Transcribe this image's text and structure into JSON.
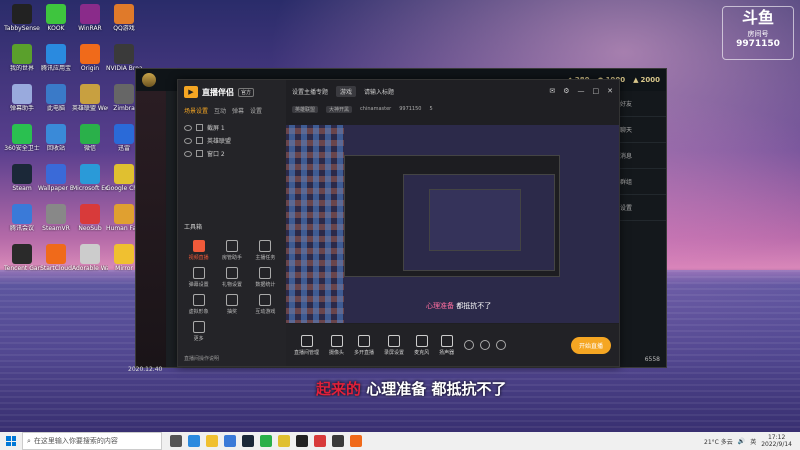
{
  "desktop": {
    "icons": [
      {
        "label": "TabbySense",
        "color": "#222"
      },
      {
        "label": "KOOK",
        "color": "#3ec53e"
      },
      {
        "label": "WinRAR",
        "color": "#8a2b8a"
      },
      {
        "label": "QQ游戏",
        "color": "#e07a2a"
      },
      {
        "label": "我的世界",
        "color": "#5aa02c"
      },
      {
        "label": "腾讯应用宝",
        "color": "#2a8adf"
      },
      {
        "label": "Origin",
        "color": "#f06a1a"
      },
      {
        "label": "NVIDIA Broadcast",
        "color": "#3a3a3a"
      },
      {
        "label": "弹幕助手",
        "color": "#9ad"
      },
      {
        "label": "此电脑",
        "color": "#3a7ac8"
      },
      {
        "label": "英雄联盟 WeGame版",
        "color": "#c8a040"
      },
      {
        "label": "Zimbra",
        "color": "#666"
      },
      {
        "label": "360安全卫士",
        "color": "#2ac050"
      },
      {
        "label": "回收站",
        "color": "#3a8ad8"
      },
      {
        "label": "微信",
        "color": "#2ab04a"
      },
      {
        "label": "迅雷",
        "color": "#2a6ad8"
      },
      {
        "label": "Steam",
        "color": "#1b2838"
      },
      {
        "label": "Wallpaper Engine",
        "color": "#3a6ad8"
      },
      {
        "label": "Microsoft Edge",
        "color": "#2a9ad8"
      },
      {
        "label": "Google Chrome",
        "color": "#e0c030"
      },
      {
        "label": "腾讯会议",
        "color": "#3a7ad8"
      },
      {
        "label": "SteamVR",
        "color": "#888"
      },
      {
        "label": "NeoSub",
        "color": "#d83a3a"
      },
      {
        "label": "Human Fall Flat",
        "color": "#e0a030"
      },
      {
        "label": "Tencent Gamemaster",
        "color": "#2a2a2a"
      },
      {
        "label": "StartCloud",
        "color": "#f06a1a"
      },
      {
        "label": "Adorable Wallpaper",
        "color": "#ccc"
      },
      {
        "label": "Mirror",
        "color": "#f0c030"
      }
    ],
    "douyu_badge": {
      "logo": "斗鱼",
      "label": "房间号",
      "room": "9971150"
    }
  },
  "game_window": {
    "stats": [
      "280",
      "1900",
      "2000"
    ],
    "side_items": [
      "好友",
      "聊天",
      "消息",
      "群组",
      "设置"
    ],
    "footer": "6558"
  },
  "stream_app": {
    "brand": "直播伴侣",
    "version": "官方",
    "left_tabs": [
      "场景设置",
      "互动",
      "弹幕",
      "设置"
    ],
    "scenes": [
      "截屏 1",
      "英雄联盟",
      "窗口 2"
    ],
    "tools_title": "工具箱",
    "tools": [
      {
        "label": "视频直播",
        "hot": true
      },
      {
        "label": "房管助手",
        "hot": false
      },
      {
        "label": "主播任务",
        "hot": false
      },
      {
        "label": "弹幕设置",
        "hot": false
      },
      {
        "label": "礼物设置",
        "hot": false
      },
      {
        "label": "数据统计",
        "hot": false
      },
      {
        "label": "虚拟形象",
        "hot": false
      },
      {
        "label": "抽奖",
        "hot": false
      },
      {
        "label": "互动游戏",
        "hot": false
      },
      {
        "label": "更多",
        "hot": false
      }
    ],
    "hint": "直播间操作说明",
    "top": {
      "title": "设置主播专题",
      "tag": "游戏",
      "edit": "请输入标题"
    },
    "sub": {
      "tag1": "英雄联盟",
      "tag2": "大神开黑",
      "user": "chinamaster",
      "room": "9971150",
      "count": "5"
    },
    "preview_title_hl": "心理准备",
    "preview_title_rest": " 都抵抗不了",
    "bottom_buttons": [
      "直播间管理",
      "摄像头",
      "多开直播",
      "录屏设置",
      "麦克风",
      "扬声器"
    ],
    "start_label": "开始直播"
  },
  "subtitle": {
    "red": "起来的",
    "white": " 心理准备 都抵抗不了"
  },
  "timestamp": "2020.12.40",
  "taskbar": {
    "search_placeholder": "在这里输入你要搜索的内容",
    "weather": "21°C 多云",
    "time": "17:12",
    "date": "2022/9/14",
    "ime": "英"
  }
}
